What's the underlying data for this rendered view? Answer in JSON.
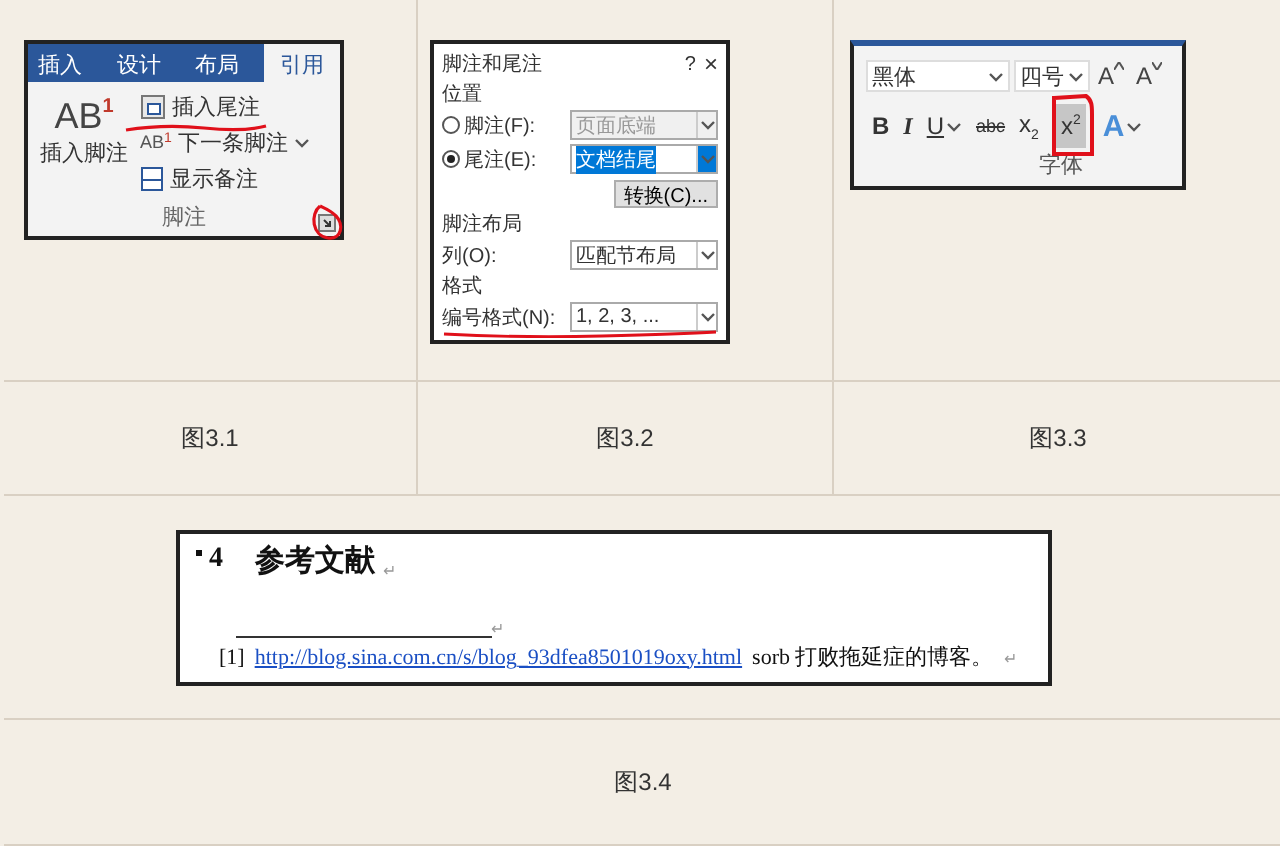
{
  "footnote_ribbon": {
    "tabs": [
      {
        "label": "插入",
        "selected": false
      },
      {
        "label": "设计",
        "selected": false
      },
      {
        "label": "布局",
        "selected": false
      },
      {
        "label": "引用",
        "selected": true
      }
    ],
    "insert_footnote": {
      "icon_text": "AB",
      "icon_mark": "1",
      "label": "插入脚注"
    },
    "commands": [
      {
        "kind": "endnote",
        "label": "插入尾注",
        "annotated": true
      },
      {
        "kind": "next",
        "label": "下一条脚注",
        "icon_text": "AB",
        "icon_mark": "1",
        "annotated": false
      },
      {
        "kind": "show",
        "label": "显示备注",
        "annotated": false
      }
    ],
    "group_label": "脚注",
    "launcher_annotated": true
  },
  "note_dialog": {
    "title": "脚注和尾注",
    "help": "?",
    "close": "×",
    "location_heading": "位置",
    "locations": [
      {
        "label": "脚注(F):",
        "selected": false,
        "value": "页面底端"
      },
      {
        "label": "尾注(E):",
        "selected": true,
        "value": "文档结尾"
      }
    ],
    "convert_button": "转换(C)...",
    "layout_heading": "脚注布局",
    "columns_label": "列(O):",
    "columns_value": "匹配节布局",
    "format_heading": "格式",
    "number_format_label": "编号格式(N):",
    "number_format_value": "1, 2, 3, ...",
    "number_format_annotated": true
  },
  "font_group": {
    "font": "黑体",
    "size": "四号",
    "grow": "A",
    "shrink": "A",
    "buttons": [
      {
        "kind": "bold",
        "label": "B",
        "selected": false,
        "annotated": false
      },
      {
        "kind": "italic",
        "label": "I",
        "selected": false,
        "annotated": false
      },
      {
        "kind": "underline",
        "label": "U",
        "selected": false,
        "annotated": false
      },
      {
        "kind": "strike",
        "label": "abc",
        "selected": false,
        "annotated": false
      },
      {
        "kind": "subscript",
        "label": "x$_{2}$",
        "selected": false,
        "annotated": false
      },
      {
        "kind": "superscript",
        "label": "x$^{2}$",
        "selected": true,
        "annotated": true
      },
      {
        "kind": "effects",
        "label": "A",
        "selected": false,
        "annotated": false
      }
    ],
    "group_label": "字体"
  },
  "captions": [
    "图3.1",
    "图3.2",
    "图3.3"
  ],
  "reference_page": {
    "heading_number": "4",
    "heading": "参考文献",
    "return_mark": "↵",
    "footnote_number": "[1]",
    "link": "http://blog.sina.com.cn/s/blog_93dfea8501019oxy.html",
    "footnote_text": "sorb 打败拖延症的博客。"
  },
  "caption_4": "图3.4"
}
